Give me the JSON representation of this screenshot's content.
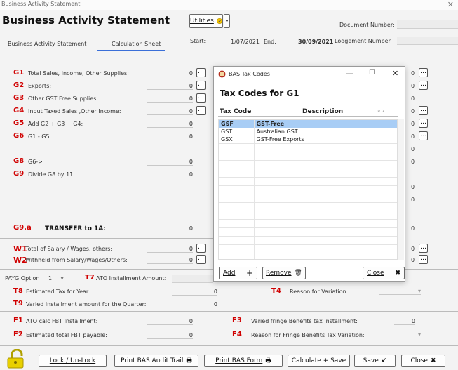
{
  "window": {
    "title": "Business Activity Statement",
    "close_glyph": "✕"
  },
  "header": {
    "title": "Business Activity Statement",
    "utilities_label": "Utilities",
    "document_number_label": "Document Number:",
    "lodgement_number_label": "Lodgement Number",
    "start_label": "Start:",
    "start_value": "1/07/2021",
    "end_label": "End:",
    "end_value": "30/09/2021"
  },
  "tabs": [
    {
      "label": "Business Activity Statement"
    },
    {
      "label": "Calculation Sheet"
    }
  ],
  "gst_rows": [
    {
      "code": "G1",
      "label": "Total Sales, Income, Other Supplies:",
      "value": "0",
      "has_button": true
    },
    {
      "code": "G2",
      "label": "Exports:",
      "value": "0",
      "has_button": true
    },
    {
      "code": "G3",
      "label": "Other GST Free Supplies:",
      "value": "0",
      "has_button": true
    },
    {
      "code": "G4",
      "label": "Input Taxed Sales ,Other Income:",
      "value": "0",
      "has_button": true
    },
    {
      "code": "G5",
      "label": "Add G2 + G3 + G4:",
      "value": "0",
      "has_button": false
    },
    {
      "code": "G6",
      "label": "G1 - G5:",
      "value": "0",
      "has_button": false
    },
    {
      "code": "G8",
      "label": "G6->",
      "value": "0",
      "has_button": false
    },
    {
      "code": "G9",
      "label": "Divide G8 by 11",
      "value": "0",
      "has_button": false
    }
  ],
  "transfer": {
    "code": "G9.a",
    "label": "TRANSFER to 1A:",
    "value": "0"
  },
  "wage_rows": [
    {
      "code": "W1",
      "label": "Total of Salary / Wages, others:",
      "value": "0"
    },
    {
      "code": "W2",
      "label": "Withheld from Salary/Wages/Others:",
      "value": "0"
    }
  ],
  "right_values": [
    "0",
    "0",
    "0",
    "0",
    "0",
    "0",
    "0",
    "0",
    "0",
    "0",
    "0",
    "0",
    "0"
  ],
  "payg": {
    "option_label": "PAYG Option",
    "option_value": "1",
    "t7_code": "T7",
    "t7_label": "ATO Installment Amount:",
    "t8_code": "T8",
    "t8_label": "Estimated Tax for Year:",
    "t8_value": "0",
    "t9_code": "T9",
    "t9_label": "Varied Installment amount for the Quarter:",
    "t9_value": "0",
    "t4_code": "T4",
    "t4_label": "Reason for Variation:"
  },
  "fbt": {
    "f1_code": "F1",
    "f1_label": "ATO calc FBT Installment:",
    "f1_value": "0",
    "f2_code": "F2",
    "f2_label": "Estimated total FBT payable:",
    "f2_value": "0",
    "f3_code": "F3",
    "f3_label": "Varied fringe Benefits tax installment:",
    "f3_value": "0",
    "f4_code": "F4",
    "f4_label": "Reason for Fringe Benefits Tax Variation:"
  },
  "footer": {
    "lock_label": "Lock / Un-Lock",
    "print_audit_label": "Print BAS Audit Trail",
    "print_form_label": "Print BAS Form",
    "calc_save_label": "Calculate + Save",
    "save_label": "Save",
    "close_label": "Close"
  },
  "dialog": {
    "window_title": "BAS Tax Codes",
    "heading": "Tax Codes for G1",
    "col_code": "Tax Code",
    "col_desc": "Description",
    "rows": [
      {
        "code": "GSF",
        "desc": "GST-Free"
      },
      {
        "code": "GST",
        "desc": "Australian GST"
      },
      {
        "code": "GSX",
        "desc": "GST-Free Exports"
      }
    ],
    "add_label": "Add",
    "remove_label": "Remove",
    "close_label": "Close"
  },
  "colors": {
    "code_red": "#d00000",
    "selection": "#a8cdf5",
    "tab_accent": "#3a6fd8"
  }
}
